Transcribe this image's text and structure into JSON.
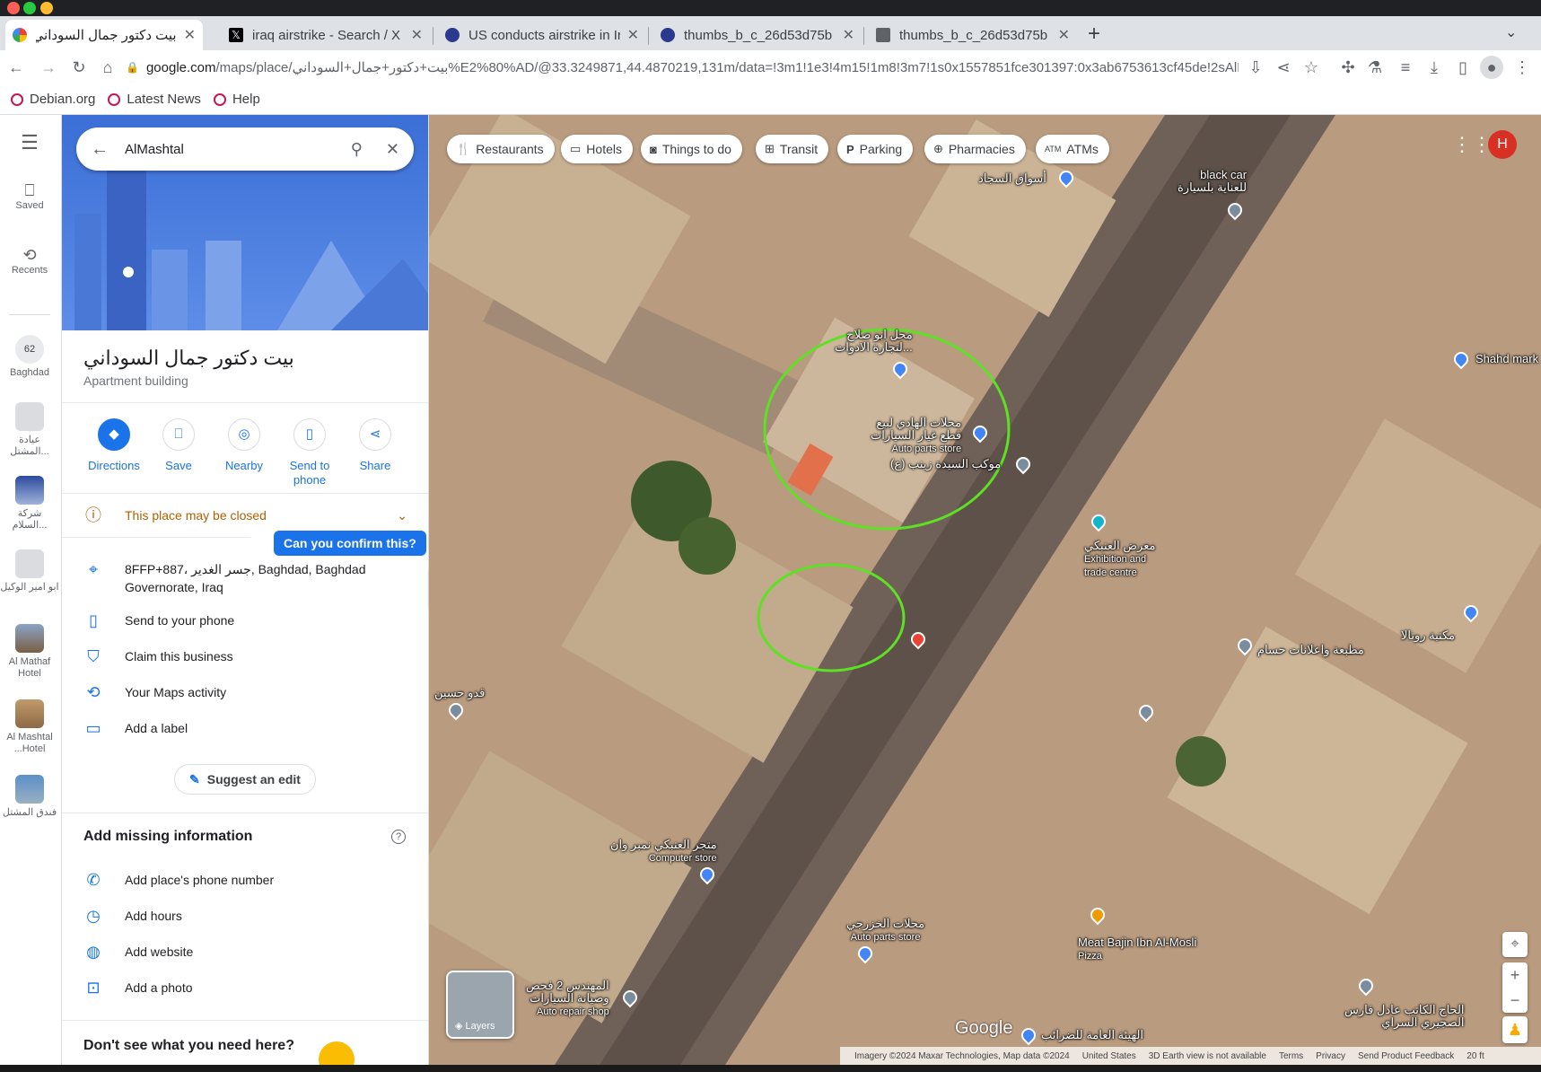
{
  "browser": {
    "tabs": [
      {
        "title": "بيت دكتور جمال السوداني",
        "favicon": "google-maps-icon",
        "active": true
      },
      {
        "title": "iraq airstrike - Search / X",
        "favicon": "x-icon"
      },
      {
        "title": "US conducts airstrike in Ir",
        "favicon": "site-icon"
      },
      {
        "title": "thumbs_b_c_26d53d75b",
        "favicon": "site-icon"
      },
      {
        "title": "thumbs_b_c_26d53d75b",
        "favicon": "image-icon"
      }
    ],
    "url_domain": "google.com",
    "url_path": "/maps/place/بيت+دكتور+جمال+السوداني%E2%80%AD/@33.3249871,44.4870219,131m/data=!3m1!1e3!4m15!1m8!3m7!1s0x1557851fce301397:0x3ab6753613cf45de!2sAlMashtal,+B...",
    "bookmarks": [
      "Debian.org",
      "Latest News",
      "Help"
    ]
  },
  "rail": {
    "saved": "Saved",
    "recents": "Recents",
    "items": [
      {
        "label": "Baghdad",
        "badge": "62"
      },
      {
        "label": "عيادة المشتل..."
      },
      {
        "label": "شركة السلام..."
      },
      {
        "label": "ابو امير الوكيل"
      },
      {
        "label": "Al Mathaf Hotel"
      },
      {
        "label": "Al Mashtal ...Hotel"
      },
      {
        "label": "فندق المشتل"
      }
    ]
  },
  "panel": {
    "search_value": "AlMashtal",
    "place_name": "بيت دكتور جمال السوداني",
    "place_type": "Apartment building",
    "actions": [
      "Directions",
      "Save",
      "Nearby",
      "Send to phone",
      "Share"
    ],
    "closed_warning": "This place may be closed",
    "confirm_tooltip": "Can you confirm this?",
    "address": "8FFP+887، جسر الغدير, Baghdad, Baghdad Governorate, Iraq",
    "send_to_phone": "Send to your phone",
    "claim": "Claim this business",
    "activity": "Your Maps activity",
    "add_label": "Add a label",
    "suggest_edit": "Suggest an edit",
    "missing_title": "Add missing information",
    "missing": [
      "Add place's phone number",
      "Add hours",
      "Add website",
      "Add a photo"
    ],
    "dont_see": "Don't see what you need here?"
  },
  "map": {
    "chips": [
      "Restaurants",
      "Hotels",
      "Things to do",
      "Transit",
      "Parking",
      "Pharmacies",
      "ATMs"
    ],
    "account_initial": "H",
    "layers": "Layers",
    "google": "Google",
    "footer": [
      "Imagery ©2024 Maxar Technologies, Map data ©2024",
      "United States",
      "3D Earth view is not available",
      "Terms",
      "Privacy",
      "Send Product Feedback",
      "20 ft"
    ],
    "labels": {
      "aswaq": "أسواق السجاد",
      "blackcar1": "black car",
      "blackcar2": "للعناية بلسيارة",
      "abusalah1": "محل ابو صلاح",
      "abusalah2": "لتجارة الادوات...",
      "hadi1": "محلات الهادي لبيع",
      "hadi2": "قطع غيار السيارات",
      "hadi3": "Auto parts store",
      "mawkib": "موكب السيدة زينب (ع)",
      "anbaki1": "معرض العنبكي",
      "anbaki2": "Exhibition and",
      "anbaki3": "trade centre",
      "shahd": "Shahd mark",
      "maktaba": "مكتبة رونالا",
      "matbaa": "مطبعة واعلانات حسام",
      "qadu": "قدو حسين",
      "comp1": "متجر العنبكي نمبر وان",
      "comp2": "Computer store",
      "khaz1": "محلات الخزرجي",
      "khaz2": "Auto parts store",
      "meat1": "Meat Bajin Ibn Al-Mosli",
      "meat2": "Pizza",
      "muh1": "المهندس 2 فحص",
      "muh2": "وصيانة السيارات",
      "muh3": "Auto repair shop",
      "haj1": "الحاج الكاتب عادل فارس",
      "haj2": "الصجيري السراي",
      "tax": "الهيئة العامة للضرائب"
    }
  }
}
